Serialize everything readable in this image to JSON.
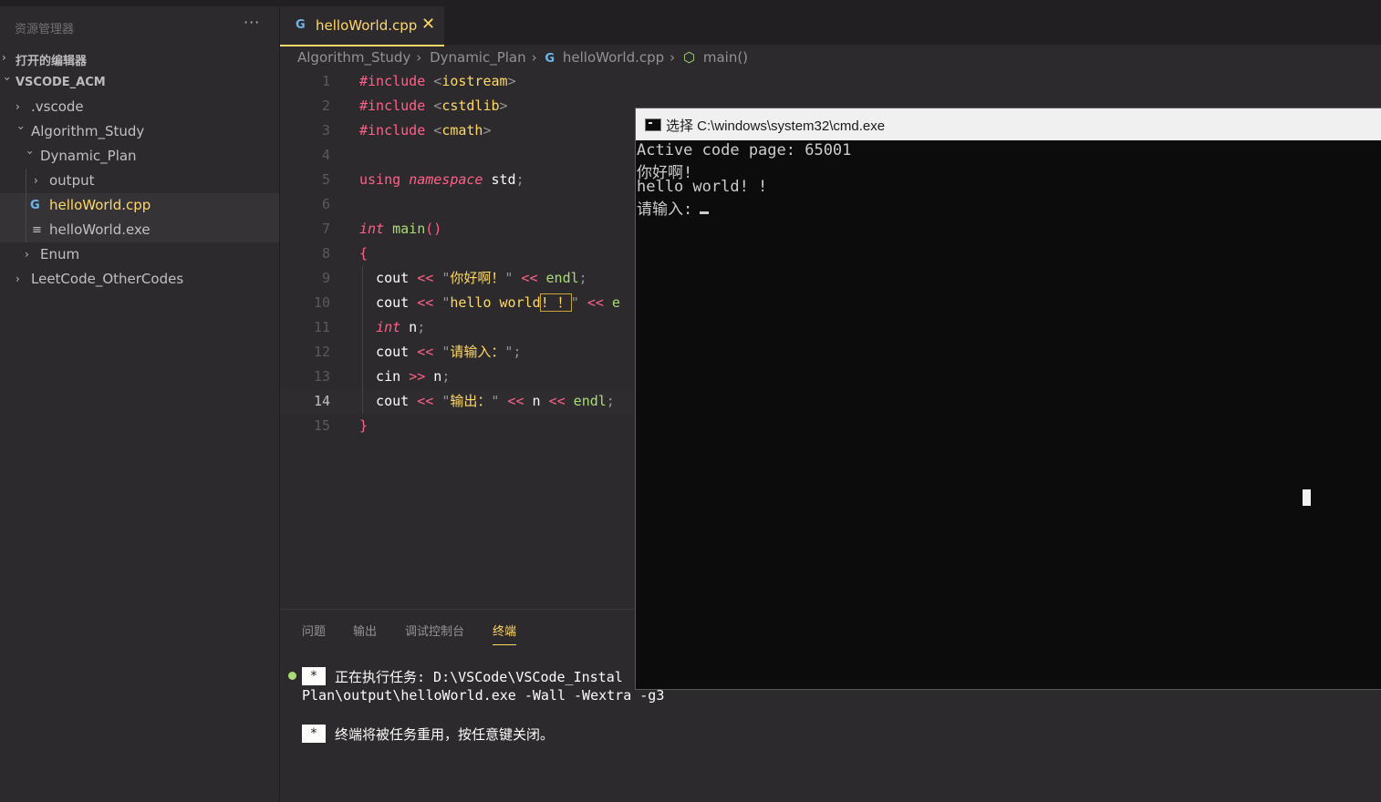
{
  "explorer": {
    "title": "资源管理器",
    "more": "···",
    "open_editors": "打开的编辑器",
    "workspace": "VSCODE_ACM",
    "items": [
      {
        "label": ".vscode"
      },
      {
        "label": "Algorithm_Study"
      },
      {
        "label": "Dynamic_Plan"
      },
      {
        "label": "output"
      },
      {
        "label": "helloWorld.cpp"
      },
      {
        "label": "helloWorld.exe"
      },
      {
        "label": "Enum"
      },
      {
        "label": "LeetCode_OtherCodes"
      }
    ]
  },
  "tab": {
    "label": "helloWorld.cpp",
    "icon": "cpp-icon",
    "close": "✕"
  },
  "breadcrumb": {
    "parts": [
      "Algorithm_Study",
      "Dynamic_Plan",
      "helloWorld.cpp",
      "main()"
    ]
  },
  "code": {
    "line_numbers": [
      "1",
      "2",
      "3",
      "4",
      "5",
      "6",
      "7",
      "8",
      "9",
      "10",
      "11",
      "12",
      "13",
      "14",
      "15"
    ],
    "current_line": "14"
  },
  "panel": {
    "tabs": [
      "问题",
      "输出",
      "调试控制台",
      "终端"
    ],
    "active_tab": "终端",
    "star": "*",
    "line1": "正在执行任务: D:\\VSCode\\VSCode_Instal",
    "line2": "Plan\\output\\helloWorld.exe -Wall -Wextra -g3",
    "line3": "终端将被任务重用，按任意键关闭。"
  },
  "cmd": {
    "title": "选择 C:\\windows\\system32\\cmd.exe",
    "lines": [
      "Active code page: 65001",
      "你好啊!",
      "hello world! !",
      "请输入:"
    ]
  },
  "colors": {
    "accent": "#ffd866",
    "keyword": "#ff6188",
    "function": "#a9dc76",
    "background": "#2d2a2e",
    "terminal_bg": "#0c0c0c"
  }
}
